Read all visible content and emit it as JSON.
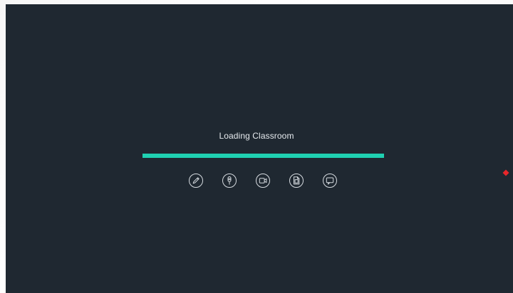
{
  "loading": {
    "label": "Loading Classroom",
    "progress_fraction": 1.0
  },
  "tools": [
    {
      "name": "pencil-icon"
    },
    {
      "name": "microphone-icon"
    },
    {
      "name": "video-camera-icon"
    },
    {
      "name": "document-icon"
    },
    {
      "name": "chat-icon"
    }
  ],
  "colors": {
    "panel_background": "#1f2831",
    "progress_accent": "#1fd1b2",
    "label_text": "#e6eaee",
    "icon_stroke": "#d6dbe0",
    "marker": "#e8262a"
  }
}
